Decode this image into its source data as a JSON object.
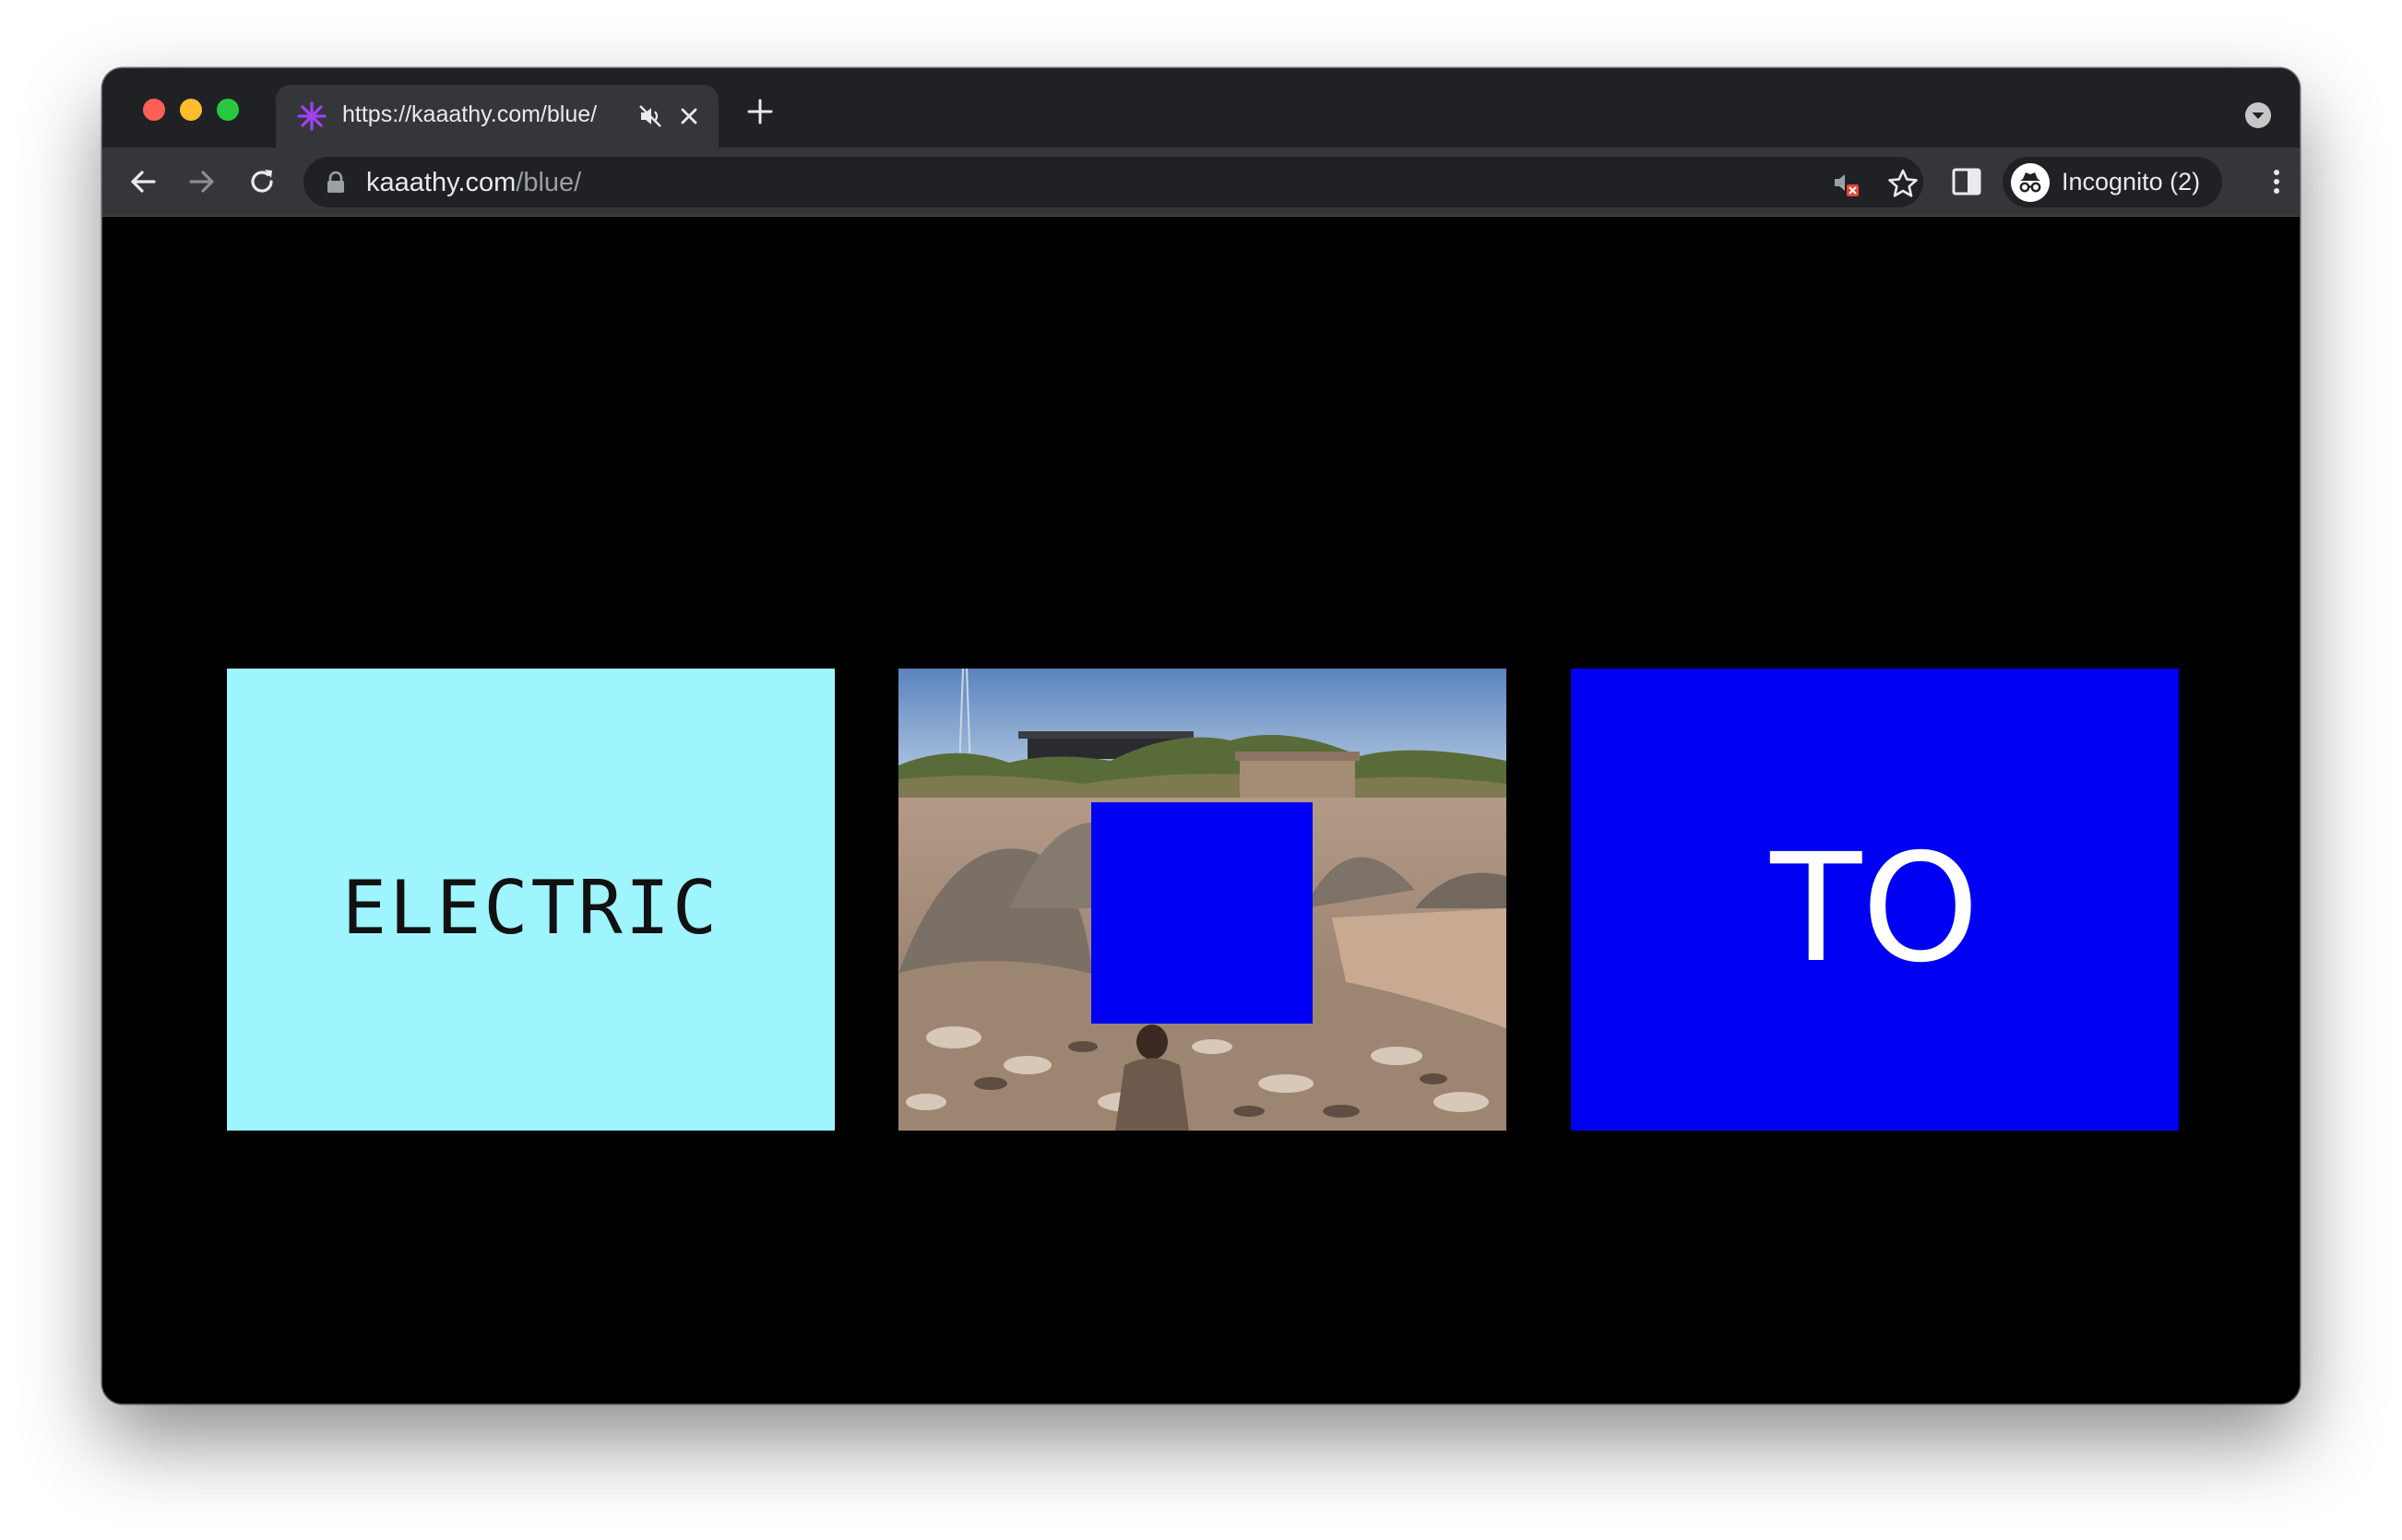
{
  "browser": {
    "tab": {
      "title": "https://kaaathy.com/blue/",
      "favicon": "asterisk-favicon-icon",
      "favicon_color": "#a142f4",
      "mute_icon": "muted-speaker-icon",
      "close_icon": "close-icon"
    },
    "new_tab_icon": "plus-icon",
    "tab_search_icon": "chevron-down-icon",
    "toolbar": {
      "back_icon": "arrow-left-icon",
      "forward_icon": "arrow-right-icon",
      "reload_icon": "reload-icon",
      "omnibox": {
        "lock_icon": "lock-icon",
        "host": "kaaathy.com",
        "path": "/blue/",
        "media_icon": "media-blocked-icon",
        "bookmark_icon": "star-icon"
      },
      "side_panel_icon": "side-panel-icon",
      "incognito": {
        "icon": "incognito-icon",
        "label": "Incognito (2)"
      },
      "menu_icon": "kebab-menu-icon"
    }
  },
  "page": {
    "background": "#000000",
    "panels": [
      {
        "type": "word",
        "text": "ELECTRIC",
        "background": "#9ff5fd",
        "text_color": "#111111"
      },
      {
        "type": "photo",
        "description_icon": "photo-with-blue-square",
        "overlay_color": "#0000f2"
      },
      {
        "type": "word",
        "text": "TO",
        "background": "#0000f2",
        "text_color": "#ffffff"
      }
    ]
  }
}
